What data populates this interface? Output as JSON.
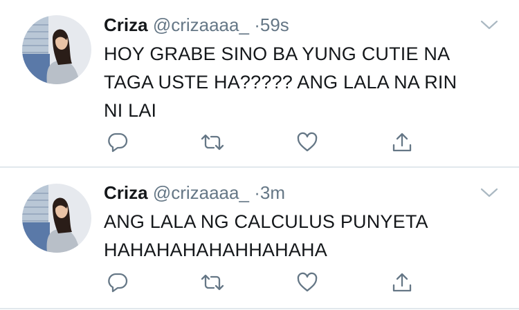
{
  "feed": {
    "tweets": [
      {
        "display_name": "Criza",
        "handle": "@crizaaaa_",
        "separator": "·",
        "time": "59s",
        "lines": [
          "HOY GRABE SINO BA YUNG CUTIE NA",
          "TAGA USTE HA????? ANG LALA NA RIN",
          "NI LAI"
        ]
      },
      {
        "display_name": "Criza",
        "handle": "@crizaaaa_",
        "separator": "·",
        "time": "3m",
        "lines": [
          "ANG LALA NG CALCULUS PUNYETA",
          "HAHAHAHAHAHHAHAHA"
        ]
      }
    ],
    "icons": {
      "reply": "reply-icon",
      "retweet": "retweet-icon",
      "like": "heart-icon",
      "share": "share-icon",
      "menu": "chevron-down-icon"
    }
  },
  "colors": {
    "text": "#14171a",
    "secondary": "#657786",
    "divider": "#e1e8ed"
  }
}
